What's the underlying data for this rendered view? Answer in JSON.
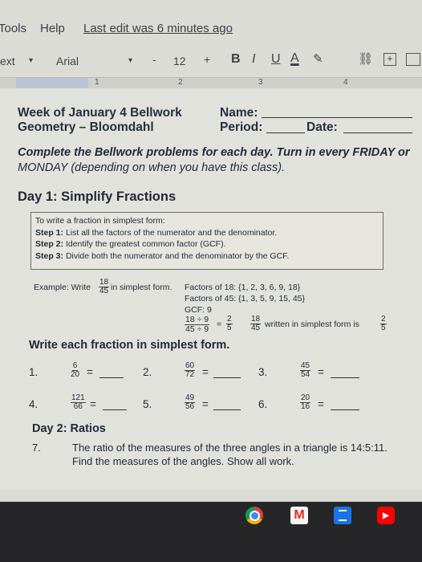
{
  "menubar": {
    "tools": "Tools",
    "help": "Help",
    "last_edit": "Last edit was 6 minutes ago"
  },
  "toolbar": {
    "style": "ext",
    "font": "Arial",
    "minus": "-",
    "size": "12",
    "plus": "+",
    "bold": "B",
    "italic": "I",
    "underline": "U",
    "textcolor": "A"
  },
  "ruler": {
    "marks": [
      "1",
      "2",
      "3",
      "4"
    ]
  },
  "doc": {
    "week": "Week of January 4 Bellwork",
    "course": "Geometry – Bloomdahl",
    "name_label": "Name:",
    "period_label": "Period:",
    "date_label": "Date:",
    "instruction_line1": "Complete the Bellwork problems for each day.  Turn in every FRIDAY or",
    "instruction_line2": "MONDAY (depending on when you have this class).",
    "day1": "Day 1:  Simplify Fractions",
    "box": {
      "intro": "To write a fraction in simplest form:",
      "step1_label": "Step 1:",
      "step1": "List all the factors of the numerator and the denominator.",
      "step2_label": "Step 2:",
      "step2": "Identify the greatest common factor (GCF).",
      "step3_label": "Step 3:",
      "step3": "Divide both the numerator and the denominator by the GCF."
    },
    "example": {
      "label": "Example:  Write",
      "in_simplest": "in simplest form.",
      "f_num": "18",
      "f_den": "45",
      "factors18": "Factors of 18:  {1, 2, 3, 6, 9, 18}",
      "factors45": "Factors of 45:  {1, 3, 5, 9, 15, 45}",
      "gcf": "GCF:  9",
      "div_num": "18 ÷ 9",
      "div_den": "45 ÷ 9",
      "eq": "=",
      "res_num": "2",
      "res_den": "5",
      "written": "written in simplest form is"
    },
    "write_each": "Write each fraction in simplest form.",
    "problems": [
      {
        "n": "1.",
        "num": "6",
        "den": "20"
      },
      {
        "n": "2.",
        "num": "60",
        "den": "72"
      },
      {
        "n": "3.",
        "num": "45",
        "den": "54"
      },
      {
        "n": "4.",
        "num": "121",
        "den": "66"
      },
      {
        "n": "5.",
        "num": "49",
        "den": "56"
      },
      {
        "n": "6.",
        "num": "20",
        "den": "16"
      }
    ],
    "eq": "=",
    "day2": "Day 2:  Ratios",
    "q7_n": "7.",
    "q7_line1": "The ratio of the measures of the three angles in a triangle is 14:5:11.",
    "q7_line2": "Find the measures of the angles.  Show all work."
  },
  "taskbar": {
    "chrome": "chrome-icon",
    "gmail": "gmail-icon",
    "docs": "docs-icon",
    "youtube": "youtube-icon",
    "gmail_letter": "M"
  },
  "colors": {
    "page": "#e2e2dc",
    "text": "#1e2a36",
    "taskbar": "#262628",
    "accent_blue": "#1a73e8"
  }
}
